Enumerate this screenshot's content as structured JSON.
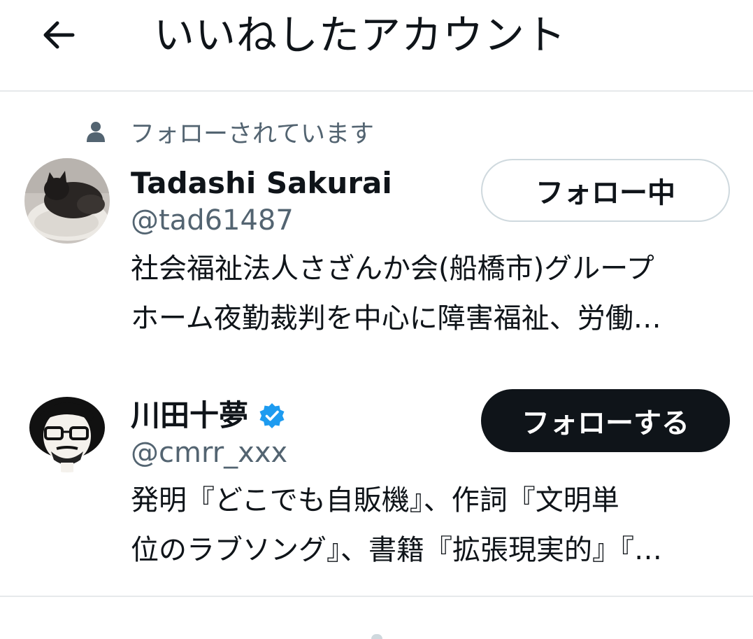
{
  "header": {
    "title": "いいねしたアカウント",
    "back_icon": "arrow-left-icon"
  },
  "users": [
    {
      "social_context": "フォローされています",
      "display_name": "Tadashi Sakurai",
      "handle": "@tad61487",
      "verified": false,
      "bio_lines": [
        "社会福祉法人さざんか会(船橋市)グループ",
        "ホーム夜勤裁判を中心に障害福祉、労働…"
      ],
      "button_label": "フォロー中",
      "button_state": "following"
    },
    {
      "display_name": "川田十夢",
      "handle": "@cmrr_xxx",
      "verified": true,
      "bio_lines": [
        "発明『どこでも自販機』、作詞『文明単",
        "位のラブソング』、書籍『拡張現実的』『…"
      ],
      "button_label": "フォローする",
      "button_state": "not-following"
    }
  ],
  "colors": {
    "primary_text": "#0f1419",
    "secondary_text": "#536471",
    "verified_blue": "#1d9bf0",
    "divider": "#e6e9eb",
    "button_border": "#cfd9de"
  }
}
